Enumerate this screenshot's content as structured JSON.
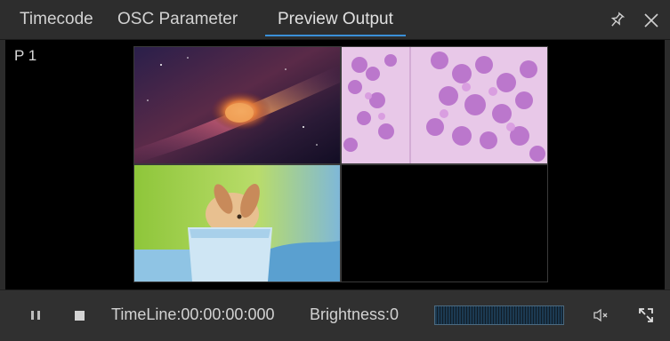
{
  "tabs": [
    {
      "label": "Timecode",
      "active": false
    },
    {
      "label": "OSC Parameter",
      "active": false
    },
    {
      "label": "Preview Output",
      "active": true
    }
  ],
  "header_icons": [
    "pin-icon",
    "close-icon"
  ],
  "preview": {
    "page_label": "P 1",
    "cells": [
      {
        "content": "space-galaxy-image"
      },
      {
        "content": "lilac-flowers-image"
      },
      {
        "content": "rabbit-in-cup-image"
      },
      {
        "content": "empty"
      }
    ]
  },
  "controls": {
    "timeline_label": "TimeLine:",
    "timeline_value": "00:00:00:000",
    "brightness_label": "Brightness:",
    "brightness_value": "0",
    "brightness_level": 0,
    "icons": [
      "pause-icon",
      "stop-icon",
      "mute-icon",
      "fullscreen-icon"
    ]
  },
  "colors": {
    "accent": "#3a8fd8",
    "background": "#2b2b2b",
    "preview_background": "#000000"
  }
}
